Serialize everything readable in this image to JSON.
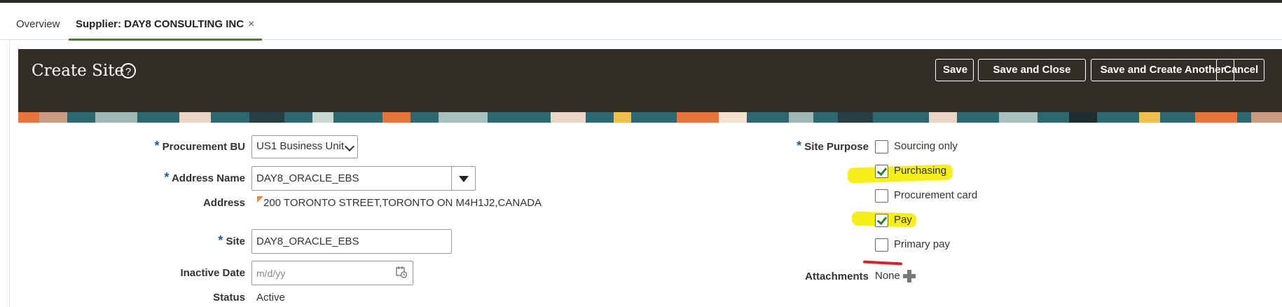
{
  "tabs": {
    "overview": "Overview",
    "supplier": "Supplier: DAY8 CONSULTING INC",
    "close_glyph": "×"
  },
  "header": {
    "title": "Create Site",
    "help_glyph": "?",
    "buttons": {
      "save": "Save",
      "save_and_close": "Save and Close",
      "save_and_create_another": "Save and Create Another",
      "cancel": "Cancel"
    }
  },
  "form": {
    "required_marker": "*",
    "procurement_bu": {
      "label": "Procurement BU",
      "value": "US1 Business Unit"
    },
    "address_name": {
      "label": "Address Name",
      "value": "DAY8_ORACLE_EBS"
    },
    "address": {
      "label": "Address",
      "value": "200 TORONTO STREET,TORONTO ON M4H1J2,CANADA"
    },
    "site": {
      "label": "Site",
      "value": "DAY8_ORACLE_EBS"
    },
    "inactive_date": {
      "label": "Inactive Date",
      "placeholder": "m/d/yy"
    },
    "status": {
      "label": "Status",
      "value": "Active"
    },
    "site_purpose": {
      "label": "Site Purpose",
      "options": [
        {
          "label": "Sourcing only",
          "checked": false
        },
        {
          "label": "Purchasing",
          "checked": true
        },
        {
          "label": "Procurement card",
          "checked": false
        },
        {
          "label": "Pay",
          "checked": true
        },
        {
          "label": "Primary pay",
          "checked": false
        }
      ]
    },
    "attachments": {
      "label": "Attachments",
      "value": "None"
    }
  },
  "colors": {
    "header_bg": "#332d28",
    "required_marker": "#1f5e9e",
    "highlight": "#f6ee1b",
    "annotation_red": "#d9232b",
    "active_tab_underline": "#4f7a3a"
  }
}
